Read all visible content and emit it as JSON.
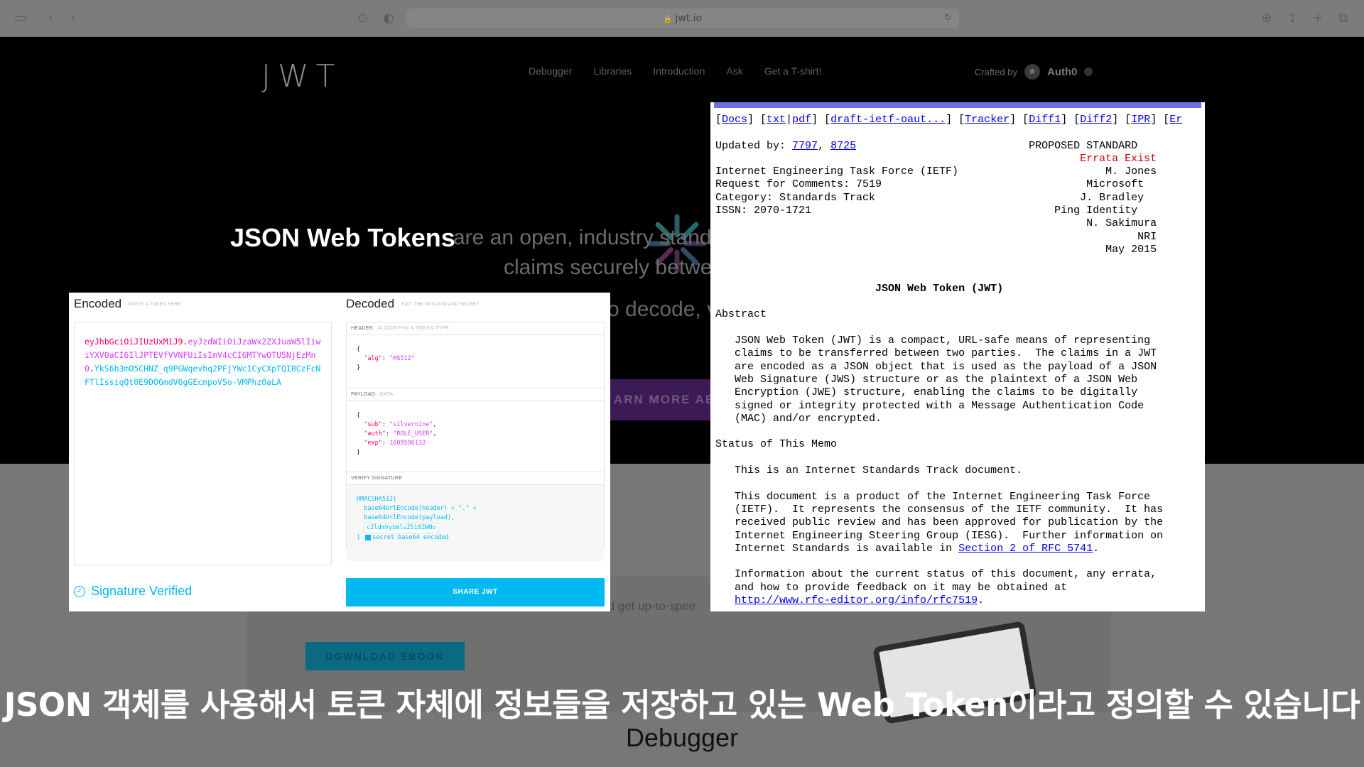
{
  "browser": {
    "url": "jwt.io"
  },
  "site": {
    "logo": "JWT",
    "nav": [
      "Debugger",
      "Libraries",
      "Introduction",
      "Ask",
      "Get a T-shirt!"
    ],
    "crafted_by": "Crafted by",
    "brand": "Auth0",
    "hero_title": "JSON Web Tokens",
    "hero_rest": "are an open, industry stand",
    "hero_line2": "claims securely betwe",
    "hero_line3": "o decode, v",
    "learn_more": "ARN MORE ABO",
    "lower_text": "nd get up-to-spee",
    "download_ebook": "DOWNLOAD EBOOK"
  },
  "debugger": {
    "encoded_title": "Encoded",
    "encoded_sub": "PASTE A TOKEN HERE",
    "decoded_title": "Decoded",
    "decoded_sub": "EDIT THE PAYLOAD AND SECRET",
    "token": {
      "header": "eyJhbGciOiJIUzUxMiJ9",
      "payload": "eyJzdWIiOiJzaWx2ZXJuaW5lIiwiYXV0aCI6IlJPTEVfVVNFUiIsImV4cCI6MTYwOTU5NjEzMn0",
      "signature": "YkS6b3mO5CHNZ_q9PGWqevhq2PFjYWc1CyCXpTQIBCzFcNFTlIssiqQt0E9DO6mdV6gGEcmpoVSo-VMPhz0aLA"
    },
    "header_label": "HEADER:",
    "header_sub": "ALGORITHM & TOKEN TYPE",
    "header_json": {
      "alg_key": "\"alg\"",
      "alg_val": "\"HS512\""
    },
    "payload_label": "PAYLOAD:",
    "payload_sub": "DATA",
    "payload_json": {
      "sub_key": "\"sub\"",
      "sub_val": "\"silvernine\"",
      "auth_key": "\"auth\"",
      "auth_val": "\"ROLE_USER\"",
      "exp_key": "\"exp\"",
      "exp_val": "1609596132"
    },
    "verify_label": "VERIFY SIGNATURE",
    "verify": {
      "fn": "HMACSHA512(",
      "line1": "base64UrlEncode(header) + \".\" +",
      "line2": "base64UrlEncode(payload),",
      "secret": "c2ldmVybmluZS10ZWNo",
      "b64": "secret base64 encoded"
    },
    "signature_verified": "Signature Verified",
    "share_jwt": "SHARE JWT"
  },
  "rfc": {
    "links": [
      "Docs",
      "txt",
      "pdf",
      "draft-ietf-oaut...",
      "Tracker",
      "Diff1",
      "Diff2",
      "IPR",
      "Er"
    ],
    "updated_by_label": "Updated by:",
    "updated_by": [
      "7797",
      "8725"
    ],
    "status": "PROPOSED STANDARD",
    "errata": "Errata Exist",
    "meta_left": [
      "Internet Engineering Task Force (IETF)",
      "Request for Comments: 7519",
      "Category: Standards Track",
      "ISSN: 2070-1721"
    ],
    "meta_right": [
      "M. Jones",
      "Microsoft",
      "J. Bradley",
      "Ping Identity",
      "N. Sakimura",
      "NRI",
      "May 2015"
    ],
    "doc_title": "JSON Web Token (JWT)",
    "abstract_heading": "Abstract",
    "abstract": [
      "JSON Web Token (JWT) is a compact, URL-safe means of representing",
      "claims to be transferred between two parties.  The claims in a JWT",
      "are encoded as a JSON object that is used as the payload of a JSON",
      "Web Signature (JWS) structure or as the plaintext of a JSON Web",
      "Encryption (JWE) structure, enabling the claims to be digitally",
      "signed or integrity protected with a Message Authentication Code",
      "(MAC) and/or encrypted."
    ],
    "memo_heading": "Status of This Memo",
    "memo_p1": "This is an Internet Standards Track document.",
    "memo_p2": [
      "This document is a product of the Internet Engineering Task Force",
      "(IETF).  It represents the consensus of the IETF community.  It has",
      "received public review and has been approved for publication by the",
      "Internet Engineering Steering Group (IESG).  Further information on"
    ],
    "memo_p2_last_prefix": "Internet Standards is available in ",
    "memo_p2_link": "Section 2 of RFC 5741",
    "memo_p3": [
      "Information about the current status of this document, any errata,",
      "and how to provide feedback on it may be obtained at"
    ],
    "memo_p3_link": "http://www.rfc-editor.org/info/rfc7519"
  },
  "captions": {
    "main": "JSON 객체를 사용해서 토큰 자체에 정보들을 저장하고 있는 Web Token이라고 정의할 수 있습니다",
    "sub": "Debugger"
  }
}
